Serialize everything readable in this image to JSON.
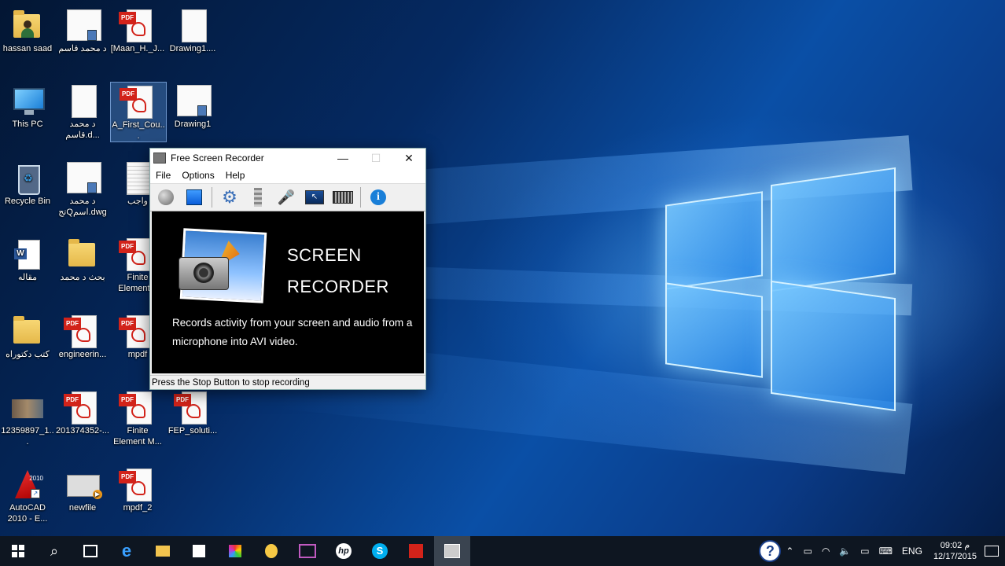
{
  "desktop": {
    "icons": [
      {
        "label": "hassan saad"
      },
      {
        "label": "د محمد قاسم"
      },
      {
        "label": "[Maan_H._J..."
      },
      {
        "label": "Drawing1...."
      },
      {
        "label": "This PC"
      },
      {
        "label": "د محمد قاسم.d..."
      },
      {
        "label": "A_First_Cou..."
      },
      {
        "label": "Drawing1"
      },
      {
        "label": "Recycle Bin"
      },
      {
        "label": "د محمد تجQاسم.dwg"
      },
      {
        "label": "واجب"
      },
      {
        "label": "مقاله"
      },
      {
        "label": "بحث د محمد"
      },
      {
        "label": "Finite Element..."
      },
      {
        "label": "كتب دكتوراه"
      },
      {
        "label": "engineerin..."
      },
      {
        "label": "mpdf"
      },
      {
        "label": "12359897_1..."
      },
      {
        "label": "201374352-..."
      },
      {
        "label": "Finite Element M..."
      },
      {
        "label": "FEP_soluti..."
      },
      {
        "label": "AutoCAD 2010 - E..."
      },
      {
        "label": "newfile"
      },
      {
        "label": "mpdf_2"
      }
    ],
    "pdf_tag": "PDF",
    "autocad_year": "2010"
  },
  "recorder": {
    "title": "Free Screen Recorder",
    "menu": [
      "File",
      "Options",
      "Help"
    ],
    "toolbar_icons": [
      "record-icon",
      "stop-icon",
      "settings-gear-icon",
      "video-film-icon",
      "microphone-icon",
      "screen-capture-icon",
      "keyboard-icon",
      "info-icon"
    ],
    "info_glyph": "i",
    "banner_title_line1": "SCREEN",
    "banner_title_line2": "RECORDER",
    "banner_text": "Records activity from your screen and audio from a microphone into AVI video.",
    "status": "Press the Stop Button to stop recording"
  },
  "taskbar": {
    "tray": {
      "help_glyph": "?",
      "language": "ENG",
      "time": "09:02 م",
      "date": "12/17/2015"
    }
  }
}
